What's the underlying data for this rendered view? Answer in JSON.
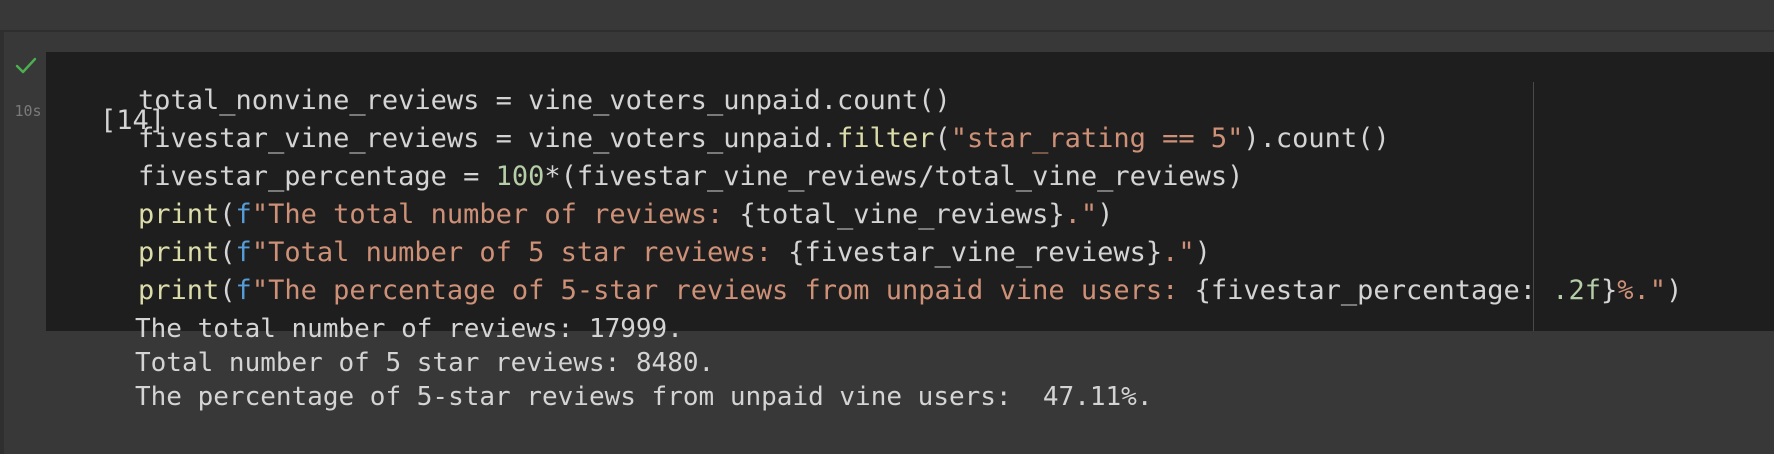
{
  "cell": {
    "execution_count": "[14]",
    "status": {
      "icon": "checkmark-icon",
      "icon_color": "#4caf50",
      "duration": "10s"
    },
    "code_lines": [
      [
        {
          "t": "plain",
          "v": "total_nonvine_reviews = vine_voters_unpaid.count()"
        }
      ],
      [
        {
          "t": "plain",
          "v": "fivestar_vine_reviews = vine_voters_unpaid."
        },
        {
          "t": "fn",
          "v": "filter"
        },
        {
          "t": "plain",
          "v": "("
        },
        {
          "t": "str",
          "v": "\"star_rating == 5\""
        },
        {
          "t": "plain",
          "v": ").count()"
        }
      ],
      [
        {
          "t": "plain",
          "v": "fivestar_percentage = "
        },
        {
          "t": "num",
          "v": "100"
        },
        {
          "t": "plain",
          "v": "*(fivestar_vine_reviews/total_vine_reviews)"
        }
      ],
      [
        {
          "t": "fn",
          "v": "print"
        },
        {
          "t": "plain",
          "v": "("
        },
        {
          "t": "kw",
          "v": "f"
        },
        {
          "t": "str",
          "v": "\"The total number of reviews: "
        },
        {
          "t": "plain",
          "v": "{total_vine_reviews}"
        },
        {
          "t": "str",
          "v": ".\""
        },
        {
          "t": "plain",
          "v": ")"
        }
      ],
      [
        {
          "t": "fn",
          "v": "print"
        },
        {
          "t": "plain",
          "v": "("
        },
        {
          "t": "kw",
          "v": "f"
        },
        {
          "t": "str",
          "v": "\"Total number of 5 star reviews: "
        },
        {
          "t": "plain",
          "v": "{fivestar_vine_reviews}"
        },
        {
          "t": "str",
          "v": ".\""
        },
        {
          "t": "plain",
          "v": ")"
        }
      ],
      [
        {
          "t": "fn",
          "v": "print"
        },
        {
          "t": "plain",
          "v": "("
        },
        {
          "t": "kw",
          "v": "f"
        },
        {
          "t": "str",
          "v": "\"The percentage of 5-star reviews from unpaid vine users: "
        },
        {
          "t": "plain",
          "v": "{fivestar_percentage: "
        },
        {
          "t": "num",
          "v": ".2f"
        },
        {
          "t": "plain",
          "v": "}"
        },
        {
          "t": "str",
          "v": "%.\""
        },
        {
          "t": "plain",
          "v": ")"
        }
      ]
    ],
    "output_lines": [
      "The total number of reviews: 17999.",
      "Total number of 5 star reviews: 8480.",
      "The percentage of 5-star reviews from unpaid vine users:  47.11%."
    ]
  },
  "colors": {
    "background": "#383838",
    "code_background": "#1e1e1e",
    "text": "#d4d4d4",
    "function": "#dcdcaa",
    "string": "#ce9178",
    "number": "#b5cea8",
    "keyword": "#569cd6",
    "success": "#4caf50"
  }
}
